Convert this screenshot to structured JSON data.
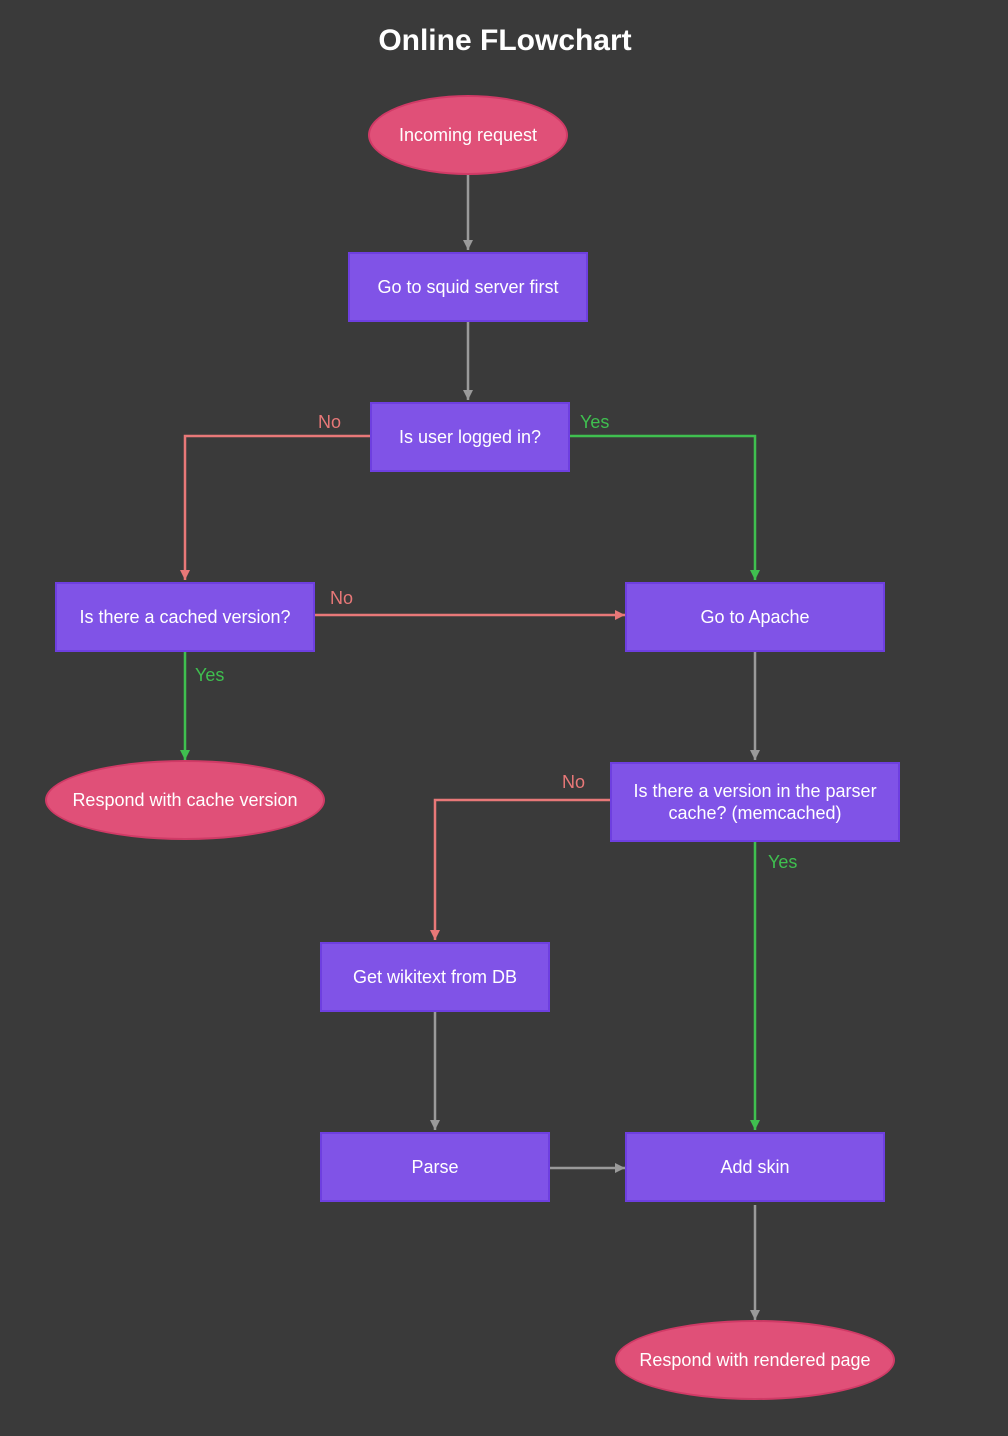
{
  "title": "Online FLowchart",
  "nodes": {
    "start": {
      "label": "Incoming request"
    },
    "squid": {
      "label": "Go to squid server first"
    },
    "logged": {
      "label": "Is user logged in?"
    },
    "cached": {
      "label": "Is there a cached version?"
    },
    "apache": {
      "label": "Go to Apache"
    },
    "respond_cache": {
      "label": "Respond with cache version"
    },
    "parser_cache": {
      "label": "Is there a version in the parser cache? (memcached)"
    },
    "get_wikitext": {
      "label": "Get wikitext from DB"
    },
    "parse": {
      "label": "Parse"
    },
    "add_skin": {
      "label": "Add skin"
    },
    "respond_page": {
      "label": "Respond with rendered page"
    }
  },
  "edges": {
    "logged_yes": "Yes",
    "logged_no": "No",
    "cached_yes": "Yes",
    "cached_no": "No",
    "parser_cache_yes": "Yes",
    "parser_cache_no": "No"
  },
  "colors": {
    "background": "#3a3a3a",
    "rect_fill": "#8053e7",
    "ellipse_fill": "#e05078",
    "arrow_gray": "#9a9a9a",
    "arrow_green": "#3fbf4f",
    "arrow_red": "#e87878",
    "text": "#ffffff"
  }
}
